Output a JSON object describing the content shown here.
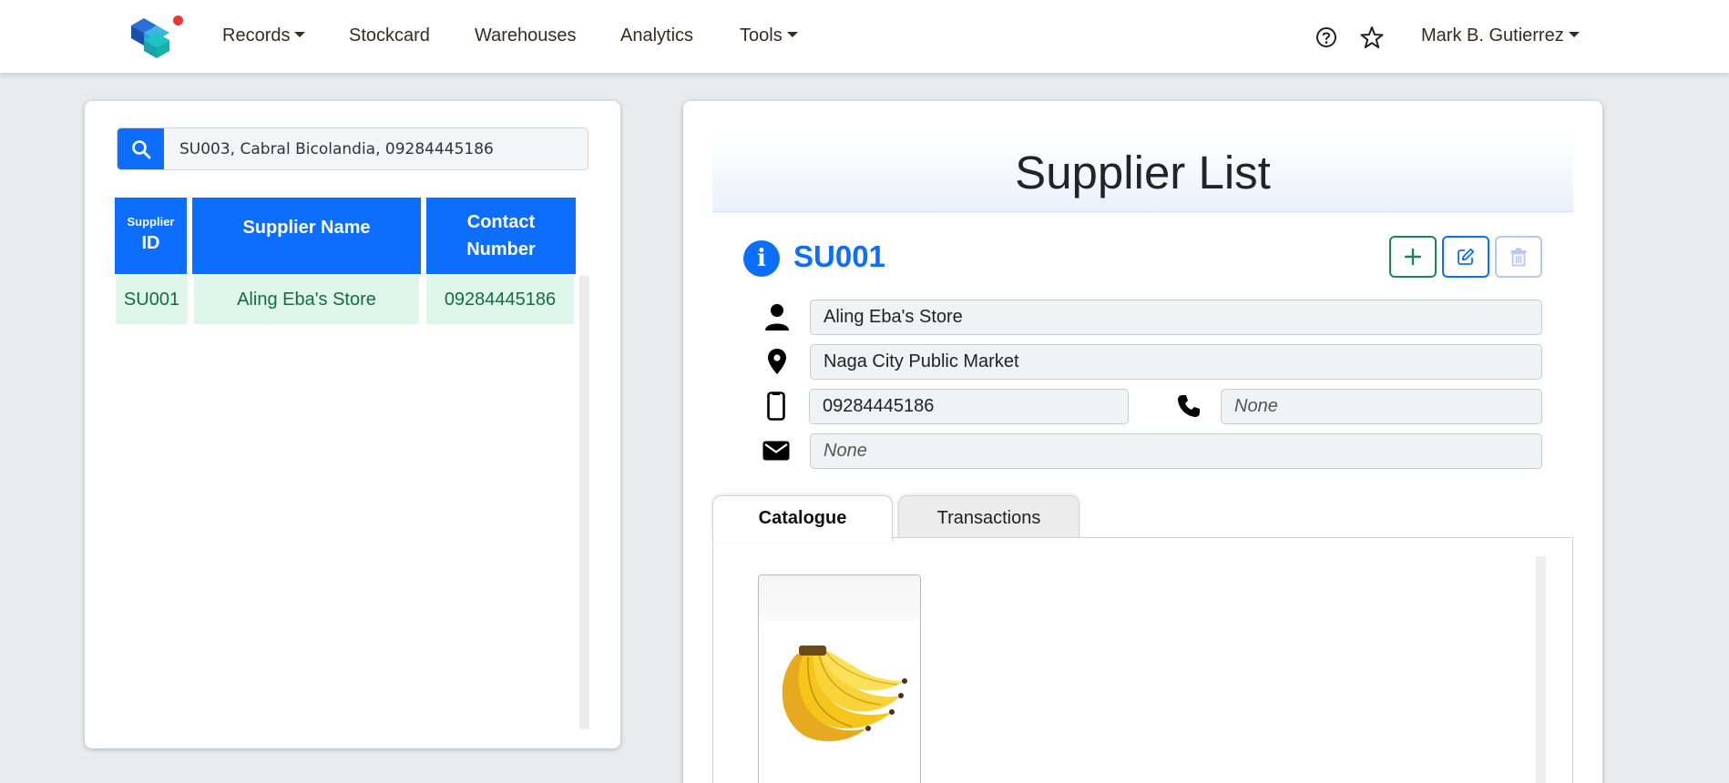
{
  "navbar": {
    "menu": [
      {
        "label": "Records",
        "has_dropdown": true
      },
      {
        "label": "Stockcard",
        "has_dropdown": false
      },
      {
        "label": "Warehouses",
        "has_dropdown": false
      },
      {
        "label": "Analytics",
        "has_dropdown": false
      },
      {
        "label": "Tools",
        "has_dropdown": true
      }
    ],
    "user_name": "Mark B. Gutierrez",
    "icons": [
      "logo-cubes",
      "help-circle-icon",
      "star-icon"
    ]
  },
  "search": {
    "value": "SU003, Cabral Bicolandia, 09284445186"
  },
  "supplier_table": {
    "headers": {
      "id_top": "Supplier",
      "id_bottom": "ID",
      "name": "Supplier Name",
      "contact_top": "Contact",
      "contact_bottom": "Number"
    },
    "rows": [
      {
        "id": "SU001",
        "name": "Aling Eba's Store",
        "contact": "09284445186"
      }
    ]
  },
  "detail": {
    "title": "Supplier List",
    "code": "SU001",
    "name": "Aling Eba's Store",
    "address": "Naga City Public Market",
    "mobile": "09284445186",
    "phone": "None",
    "email": "None"
  },
  "tabs": {
    "active": "Catalogue",
    "inactive": "Transactions"
  },
  "colors": {
    "primary": "#0d6efd",
    "success": "#198754",
    "row_bg": "#def7ea",
    "row_text": "#146c43"
  }
}
